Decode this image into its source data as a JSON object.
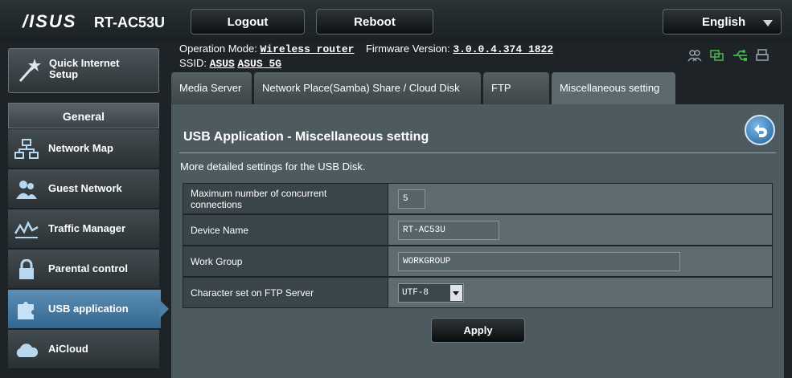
{
  "header": {
    "logo": "/ISUS",
    "model": "RT-AC53U",
    "logout_label": "Logout",
    "reboot_label": "Reboot",
    "language": "English"
  },
  "info": {
    "operation_mode_label": "Operation Mode:",
    "operation_mode_value": "Wireless router",
    "firmware_label": "Firmware Version:",
    "firmware_value": "3.0.0.4.374_1822",
    "ssid_label": "SSID:",
    "ssid_1": "ASUS",
    "ssid_2": "ASUS_5G"
  },
  "status_icons": [
    "clients-icon",
    "network-status-icon",
    "usb-status-icon",
    "printer-icon"
  ],
  "sidebar": {
    "quick_setup": "Quick Internet Setup",
    "section": "General",
    "items": [
      {
        "label": "Network Map",
        "icon": "network-map-icon"
      },
      {
        "label": "Guest Network",
        "icon": "guest-network-icon"
      },
      {
        "label": "Traffic Manager",
        "icon": "traffic-manager-icon"
      },
      {
        "label": "Parental control",
        "icon": "lock-icon"
      },
      {
        "label": "USB application",
        "icon": "usb-puzzle-icon",
        "active": true
      },
      {
        "label": "AiCloud",
        "icon": "cloud-icon"
      }
    ]
  },
  "tabs": [
    {
      "label": "Media Server"
    },
    {
      "label": "Network Place(Samba) Share / Cloud Disk"
    },
    {
      "label": "FTP Share"
    },
    {
      "label": "Miscellaneous setting",
      "active": true
    }
  ],
  "main": {
    "title": "USB Application - Miscellaneous setting",
    "description": "More detailed settings for the USB Disk.",
    "rows": [
      {
        "label": "Maximum number of concurrent connections",
        "value": "5"
      },
      {
        "label": "Device Name",
        "value": "RT-AC53U"
      },
      {
        "label": "Work Group",
        "value": "WORKGROUP"
      },
      {
        "label": "Character set on FTP Server",
        "value": "UTF-8"
      }
    ],
    "apply_label": "Apply"
  },
  "colors": {
    "accent": "#4a7ea6",
    "panel": "#4d5b61",
    "active_icon": "#4caf50"
  }
}
